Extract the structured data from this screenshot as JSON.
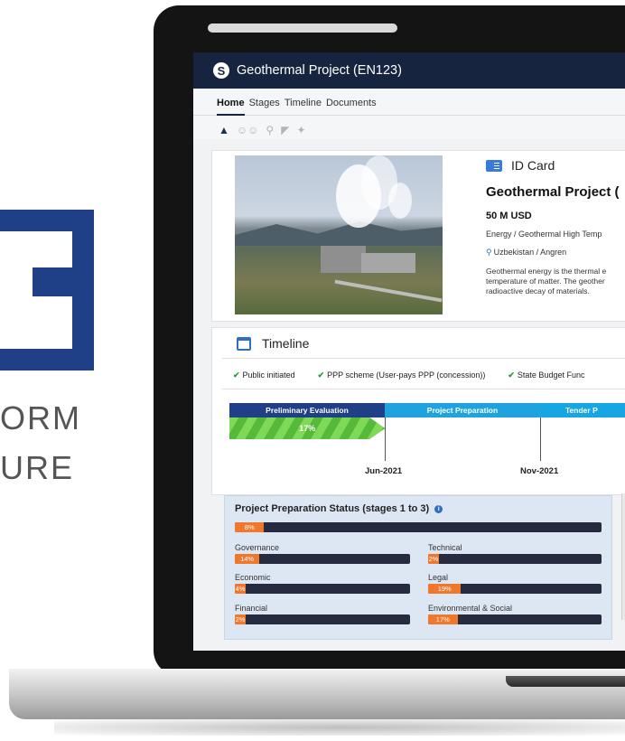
{
  "brand": {
    "line1": "ORM",
    "line2": "URE"
  },
  "app": {
    "title": "Geothermal Project (EN123)",
    "logo_glyph": "S"
  },
  "nav": {
    "tabs": [
      "Home",
      "Stages",
      "Timeline",
      "Documents"
    ]
  },
  "icon_row": [
    "home-icon",
    "people-icon",
    "search-icon",
    "gauge-icon",
    "handshake-icon"
  ],
  "id_card": {
    "title": "ID Card",
    "project_name": "Geothermal Project (",
    "amount": "50 M USD",
    "sector": "Energy / Geothermal High Temp",
    "location": "Uzbekistan / Angren",
    "description_lines": [
      "Geothermal energy is the thermal e",
      "temperature of matter. The geother",
      "radioactive decay of materials."
    ]
  },
  "timeline": {
    "title": "Timeline",
    "checks": [
      "Public initiated",
      "PPP scheme (User-pays PPP (concession))",
      "State Budget Func"
    ],
    "stages": [
      "Preliminary Evaluation",
      "Project Preparation",
      "Tender P"
    ],
    "progress": {
      "label": "17%",
      "fraction": 0.17
    },
    "dates": [
      "Jun-2021",
      "Nov-2021"
    ]
  },
  "status": {
    "title": "Project Preparation Status (stages 1 to 3)",
    "info_glyph": "i",
    "overall": {
      "label": "8%",
      "fraction": 0.08
    },
    "items": [
      {
        "name": "Governance",
        "label": "14%",
        "fraction": 0.14
      },
      {
        "name": "Technical",
        "label": "2%",
        "fraction": 0.02
      },
      {
        "name": "Economic",
        "label": "4%",
        "fraction": 0.04
      },
      {
        "name": "Legal",
        "label": "19%",
        "fraction": 0.19
      },
      {
        "name": "Financial",
        "label": "2%",
        "fraction": 0.02
      },
      {
        "name": "Environmental & Social",
        "label": "17%",
        "fraction": 0.17
      }
    ]
  },
  "colors": {
    "brand_blue": "#1f3f86",
    "header_navy": "#172440",
    "stage_blue": "#1fa3dd",
    "progress_green": "#57b93a",
    "bar_orange": "#f0782c",
    "bar_dark": "#262b3f",
    "status_bg": "#dde7f3"
  }
}
